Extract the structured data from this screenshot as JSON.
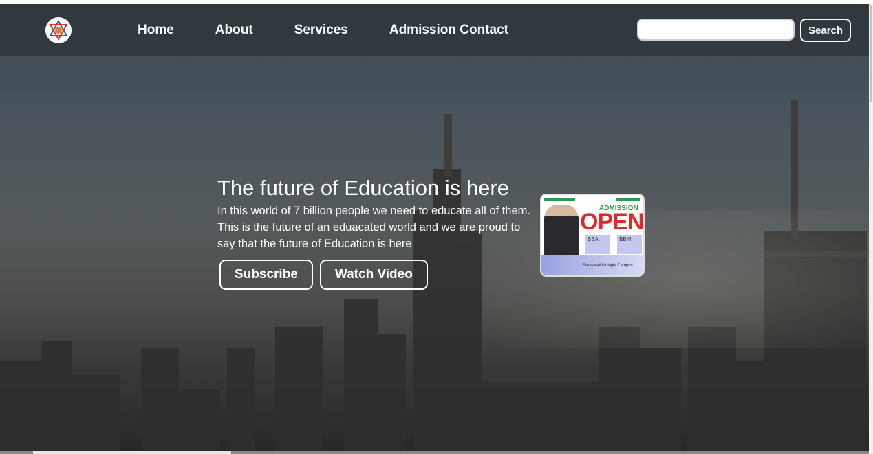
{
  "nav": {
    "logo_icon": "campus-emblem-icon",
    "links": [
      "Home",
      "About",
      "Services",
      "Admission Contact"
    ],
    "search_placeholder": "",
    "search_button": "Search"
  },
  "hero": {
    "title": "The future of Education is here",
    "text": "In this world of 7 billion people we need to educate all of them. This is the future of an eduacated world and we are proud to say that the future of Education is here",
    "buttons": [
      "Subscribe",
      "Watch Video"
    ]
  },
  "poster": {
    "admission": "ADMISSION",
    "open": "OPEN",
    "card1_title": "BBA",
    "card2_title": "BBM",
    "campus": "Saraswati Multiple Campus"
  },
  "colors": {
    "poster_green": "#2a9d4a",
    "poster_red": "#e02a2a"
  }
}
